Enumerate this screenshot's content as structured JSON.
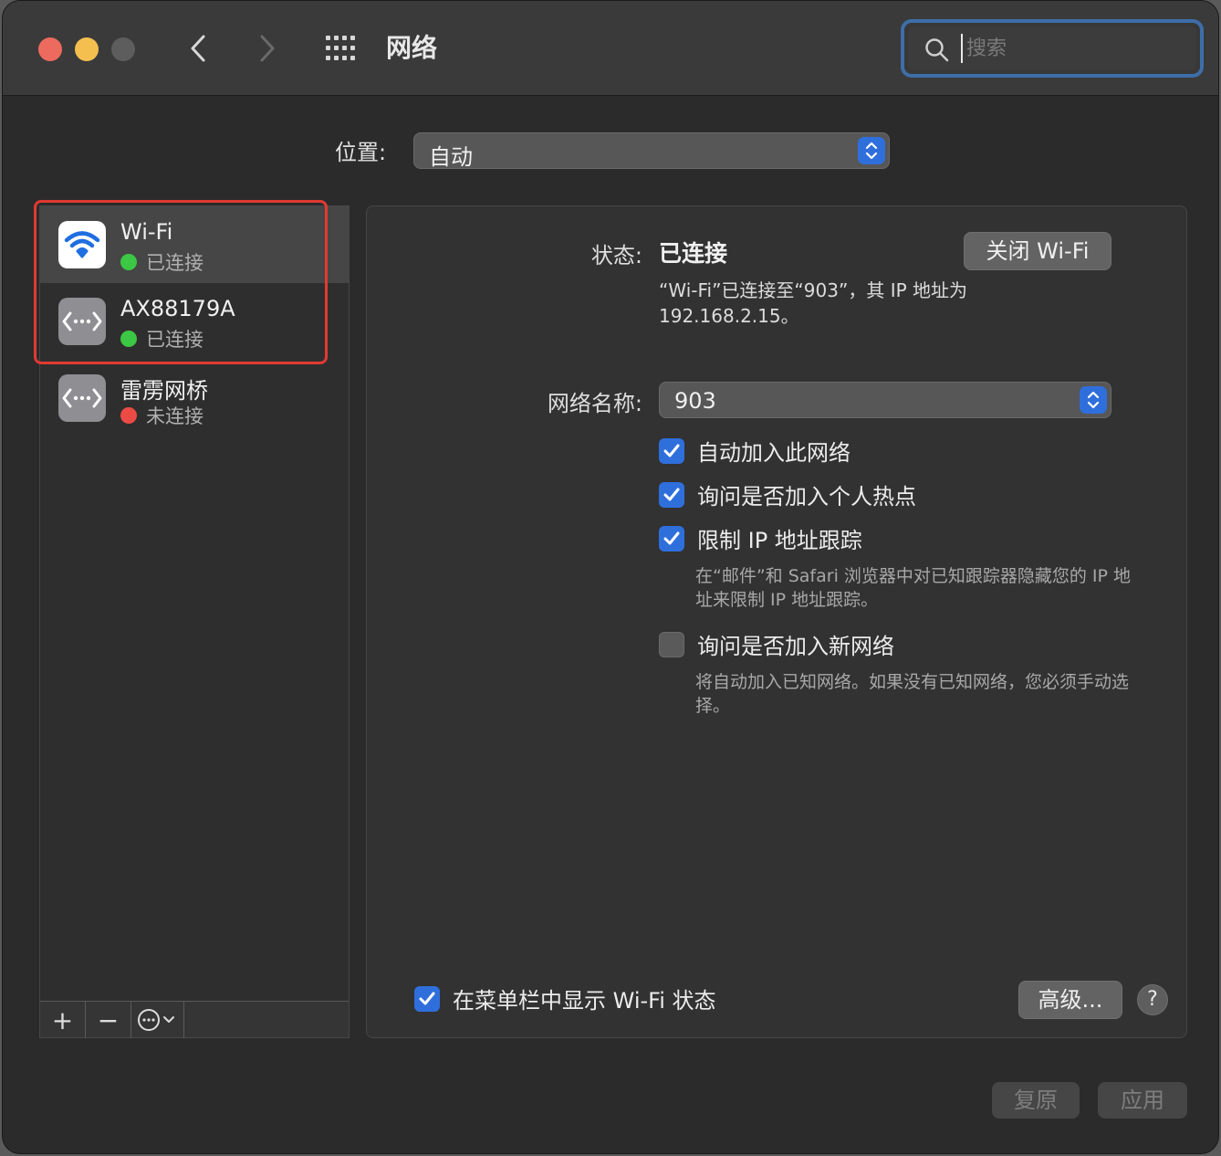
{
  "window": {
    "title": "网络",
    "search_placeholder": "搜索"
  },
  "location": {
    "label": "位置:",
    "value": "自动"
  },
  "sidebar": {
    "services": [
      {
        "name": "Wi-Fi",
        "status": "已连接",
        "status_color": "#3cc745",
        "icon": "wifi-icon",
        "selected": true
      },
      {
        "name": "AX88179A",
        "status": "已连接",
        "status_color": "#3cc745",
        "icon": "ethernet-icon",
        "selected": false
      },
      {
        "name": "雷雳网桥",
        "status": "未连接",
        "status_color": "#ec4b45",
        "icon": "ethernet-icon",
        "selected": false
      }
    ],
    "toolbar": {
      "add": "+",
      "remove": "−"
    }
  },
  "detail": {
    "status_label": "状态:",
    "status_value": "已连接",
    "turn_off_button": "关闭 Wi-Fi",
    "status_description": "“Wi-Fi”已连接至“903”，其 IP 地址为 192.168.2.15。",
    "network_name_label": "网络名称:",
    "network_name_value": "903",
    "options": [
      {
        "label": "自动加入此网络",
        "checked": true
      },
      {
        "label": "询问是否加入个人热点",
        "checked": true
      },
      {
        "label": "限制 IP 地址跟踪",
        "checked": true
      },
      {
        "label": "询问是否加入新网络",
        "checked": false
      }
    ],
    "limit_ip_hint": "在“邮件”和 Safari 浏览器中对已知跟踪器隐藏您的 IP 地址来限制 IP 地址跟踪。",
    "ask_join_hint": "将自动加入已知网络。如果没有已知网络，您必须手动选择。",
    "show_in_menubar": {
      "label": "在菜单栏中显示 Wi-Fi 状态",
      "checked": true
    },
    "advanced_button": "高级...",
    "help_button": "?"
  },
  "footer": {
    "revert_button": "复原",
    "apply_button": "应用"
  },
  "colors": {
    "accent": "#2f6fdc",
    "highlight_box": "#e03a32"
  }
}
